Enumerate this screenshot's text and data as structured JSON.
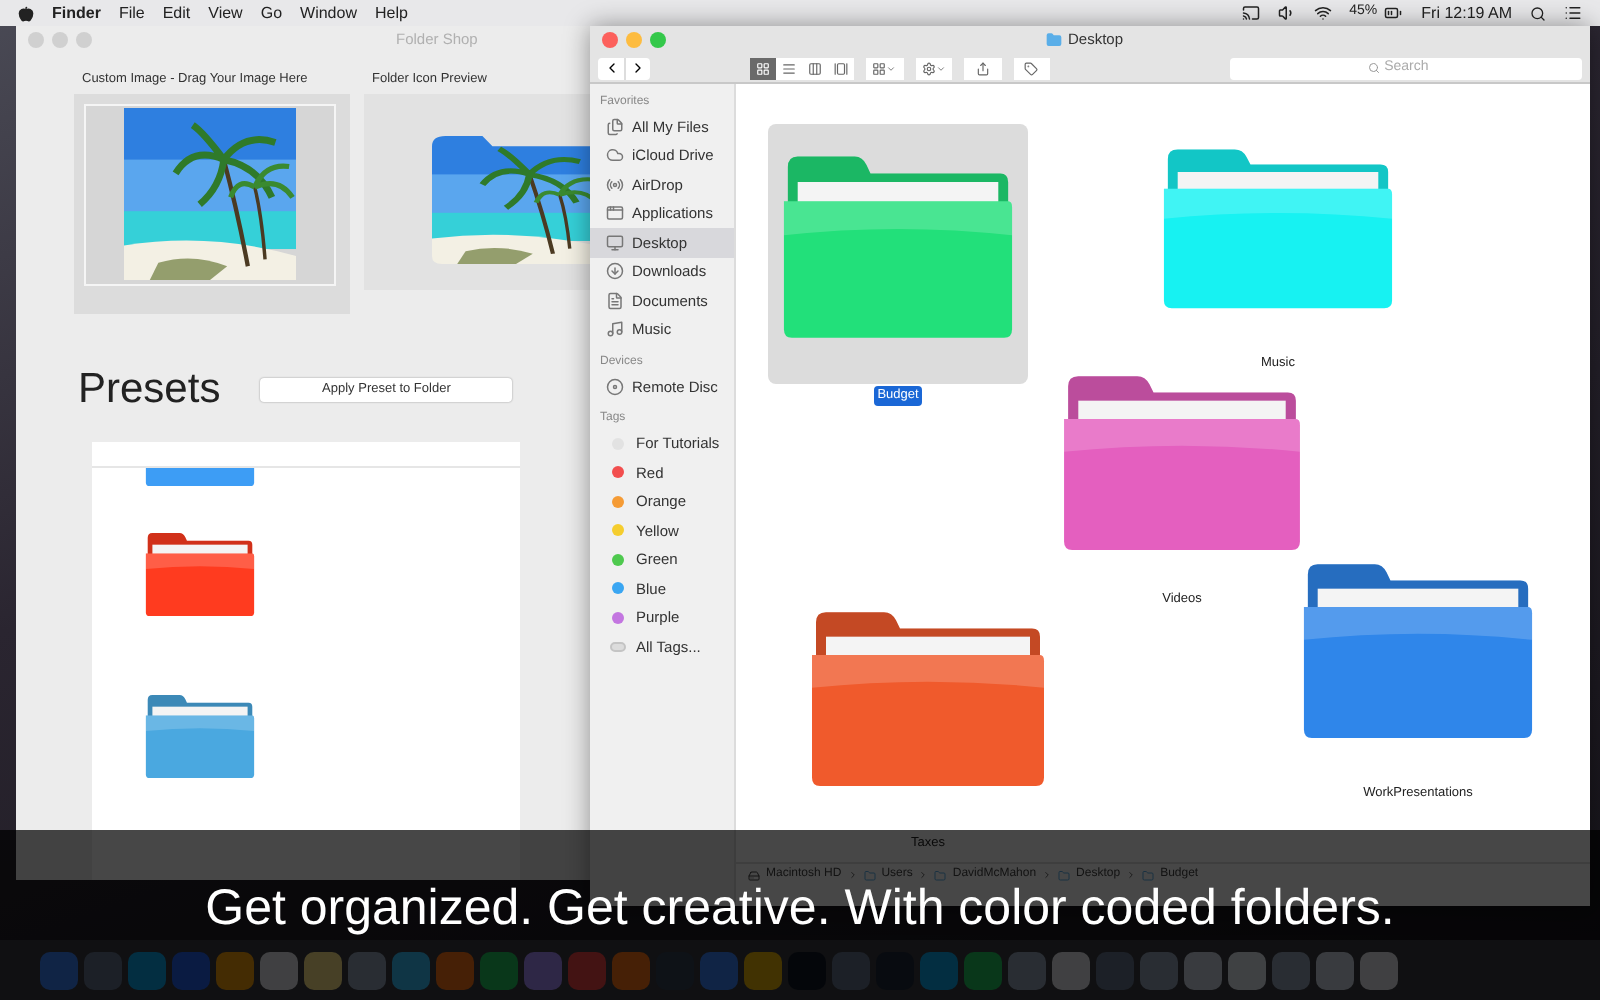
{
  "menubar": {
    "app": "Finder",
    "menus": [
      "File",
      "Edit",
      "View",
      "Go",
      "Window",
      "Help"
    ],
    "battery": "45%",
    "clock": "Fri 12:19 AM"
  },
  "folder_shop": {
    "title": "Folder Shop",
    "custom_image_label": "Custom Image - Drag Your Image Here",
    "preview_label": "Folder Icon Preview",
    "presets_title": "Presets",
    "apply_button": "Apply Preset to Folder",
    "presets": [
      {
        "color": "#3d9df5"
      },
      {
        "color": "#ff3b1f"
      },
      {
        "color": "#4aa8e0"
      }
    ]
  },
  "finder": {
    "title": "Desktop",
    "views": [
      {
        "selected": true
      },
      {
        "selected": false
      },
      {
        "selected": false
      },
      {
        "selected": false
      }
    ],
    "search": {
      "placeholder": "Search"
    },
    "sidebar": [
      {
        "heading": "Favorites",
        "items": [
          {
            "label": "All My Files",
            "selected": false
          },
          {
            "label": "iCloud Drive",
            "selected": false
          },
          {
            "label": "AirDrop",
            "selected": false
          },
          {
            "label": "Applications",
            "selected": false
          },
          {
            "label": "Desktop",
            "selected": true
          },
          {
            "label": "Downloads",
            "selected": false
          },
          {
            "label": "Documents",
            "selected": false
          },
          {
            "label": "Music",
            "selected": false
          }
        ]
      },
      {
        "heading": "Devices",
        "items": [
          {
            "label": "Remote Disc",
            "selected": false
          }
        ]
      }
    ],
    "tags_heading": "Tags",
    "tags": [
      {
        "label": "For Tutorials",
        "kind": "dot",
        "color": "#e2e2e2"
      },
      {
        "label": "Red",
        "kind": "dot",
        "color": "#f24e4e"
      },
      {
        "label": "Orange",
        "kind": "dot",
        "color": "#f59b35"
      },
      {
        "label": "Yellow",
        "kind": "dot",
        "color": "#f5cd2e"
      },
      {
        "label": "Green",
        "kind": "dot",
        "color": "#4ec94e"
      },
      {
        "label": "Blue",
        "kind": "dot",
        "color": "#3aa6f2"
      },
      {
        "label": "Purple",
        "kind": "dot",
        "color": "#c376e0"
      },
      {
        "label": "All Tags...",
        "kind": "all"
      }
    ],
    "files": [
      {
        "label": "Budget",
        "color": "#22e07a",
        "selected": true
      },
      {
        "label": "Music",
        "color": "#17f2f2",
        "selected": false
      },
      {
        "label": "Videos",
        "color": "#e45fbf",
        "selected": false
      },
      {
        "label": "Taxes",
        "color": "#f05a2c",
        "selected": false
      },
      {
        "label": "WorkPresentations",
        "color": "#2f86ea",
        "selected": false
      }
    ],
    "path": [
      "Macintosh HD",
      "Users",
      "DavidMcMahon",
      "Desktop",
      "Budget"
    ]
  },
  "caption": "Get organized. Get creative. With color coded folders."
}
